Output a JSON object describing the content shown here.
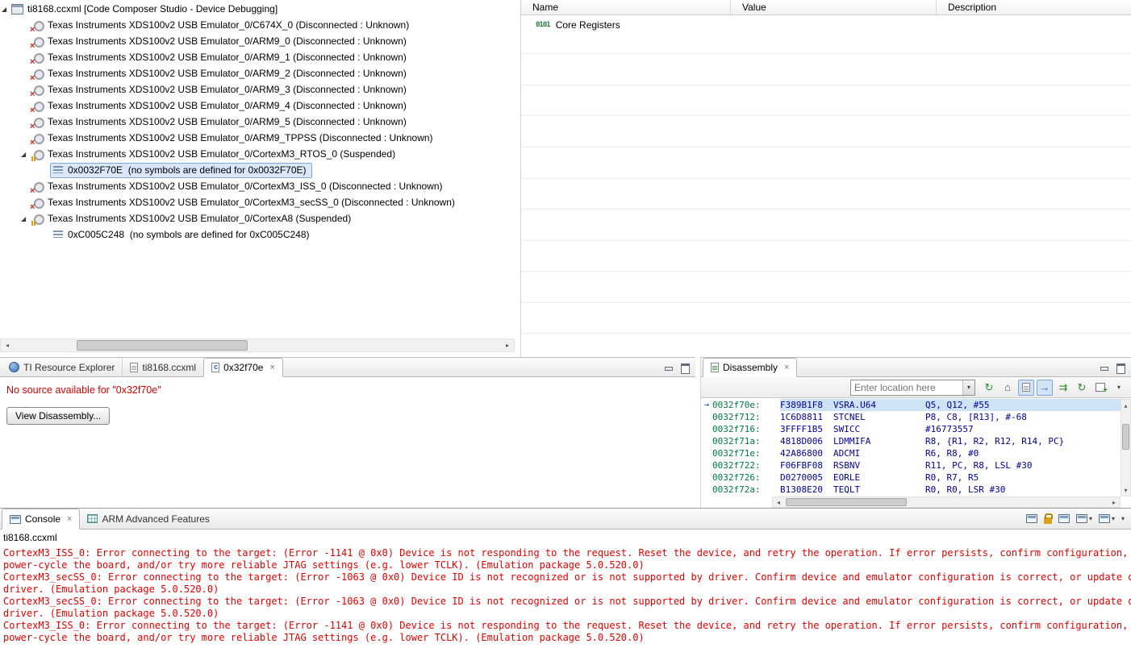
{
  "icons": {
    "expanded_twist": "◢",
    "close": "×",
    "dropdown": "▾",
    "scroll_left": "◂",
    "scroll_right": "▸",
    "scroll_up": "▴",
    "scroll_down": "▾",
    "instruction_pointer": "→",
    "home": "⌂",
    "refresh": "↻",
    "step_arrows": "⇉",
    "registers_bits": "0101"
  },
  "debug_tree": {
    "rows": [
      {
        "label": "ti8168.ccxml [Code Composer Studio - Device Debugging]"
      },
      {
        "label": "Texas Instruments XDS100v2 USB Emulator_0/C674X_0 (Disconnected : Unknown)"
      },
      {
        "label": "Texas Instruments XDS100v2 USB Emulator_0/ARM9_0 (Disconnected : Unknown)"
      },
      {
        "label": "Texas Instruments XDS100v2 USB Emulator_0/ARM9_1 (Disconnected : Unknown)"
      },
      {
        "label": "Texas Instruments XDS100v2 USB Emulator_0/ARM9_2 (Disconnected : Unknown)"
      },
      {
        "label": "Texas Instruments XDS100v2 USB Emulator_0/ARM9_3 (Disconnected : Unknown)"
      },
      {
        "label": "Texas Instruments XDS100v2 USB Emulator_0/ARM9_4 (Disconnected : Unknown)"
      },
      {
        "label": "Texas Instruments XDS100v2 USB Emulator_0/ARM9_5 (Disconnected : Unknown)"
      },
      {
        "label": "Texas Instruments XDS100v2 USB Emulator_0/ARM9_TPPSS (Disconnected : Unknown)"
      },
      {
        "label": "Texas Instruments XDS100v2 USB Emulator_0/CortexM3_RTOS_0 (Suspended)"
      },
      {
        "label": "0x0032F70E  (no symbols are defined for 0x0032F70E)"
      },
      {
        "label": "Texas Instruments XDS100v2 USB Emulator_0/CortexM3_ISS_0 (Disconnected : Unknown)"
      },
      {
        "label": "Texas Instruments XDS100v2 USB Emulator_0/CortexM3_secSS_0 (Disconnected : Unknown)"
      },
      {
        "label": "Texas Instruments XDS100v2 USB Emulator_0/CortexA8 (Suspended)"
      },
      {
        "label": "0xC005C248  (no symbols are defined for 0xC005C248)"
      }
    ]
  },
  "registers": {
    "columns": [
      "Name",
      "Value",
      "Description"
    ],
    "rows": [
      {
        "name": "Core Registers",
        "value": "",
        "description": ""
      }
    ]
  },
  "editor": {
    "tabs": [
      {
        "label": "TI Resource Explorer"
      },
      {
        "label": "ti8168.ccxml"
      },
      {
        "label": "0x32f70e"
      }
    ],
    "message": "No source available for \"0x32f70e\"",
    "button_label": "View Disassembly..."
  },
  "disassembly": {
    "tab_label": "Disassembly",
    "location_placeholder": "Enter location here",
    "rows": [
      {
        "addr": "0032f70e:",
        "code": "F389B1F8",
        "mn": "VSRA.U64",
        "ops": "Q5, Q12, #55"
      },
      {
        "addr": "0032f712:",
        "code": "1C6D8811",
        "mn": "STCNEL",
        "ops": "P8, C8, [R13], #-68"
      },
      {
        "addr": "0032f716:",
        "code": "3FFFF1B5",
        "mn": "SWICC",
        "ops": "#16773557"
      },
      {
        "addr": "0032f71a:",
        "code": "4818D006",
        "mn": "LDMMIFA",
        "ops": "R8, {R1, R2, R12, R14, PC}"
      },
      {
        "addr": "0032f71e:",
        "code": "42A86800",
        "mn": "ADCMI",
        "ops": "R6, R8, #0"
      },
      {
        "addr": "0032f722:",
        "code": "F06FBF08",
        "mn": "RSBNV",
        "ops": "R11, PC, R8, LSL #30"
      },
      {
        "addr": "0032f726:",
        "code": "D0270005",
        "mn": "EORLE",
        "ops": "R0, R7, R5"
      },
      {
        "addr": "0032f72a:",
        "code": "B1308E20",
        "mn": "TEQLT",
        "ops": "R0, R0, LSR #30"
      }
    ]
  },
  "console": {
    "tabs": [
      {
        "label": "Console"
      },
      {
        "label": "ARM Advanced Features"
      }
    ],
    "title": "ti8168.ccxml",
    "lines": [
      "CortexM3_ISS_0: Error connecting to the target: (Error -1141 @ 0x0) Device is not responding to the request. Reset the device, and retry the operation. If error persists, confirm configuration,",
      "power-cycle the board, and/or try more reliable JTAG settings (e.g. lower TCLK). (Emulation package 5.0.520.0)",
      "CortexM3_secSS_0: Error connecting to the target: (Error -1063 @ 0x0) Device ID is not recognized or is not supported by driver. Confirm device and emulator configuration is correct, or update device",
      "driver. (Emulation package 5.0.520.0)",
      "CortexM3_secSS_0: Error connecting to the target: (Error -1063 @ 0x0) Device ID is not recognized or is not supported by driver. Confirm device and emulator configuration is correct, or update device",
      "driver. (Emulation package 5.0.520.0)",
      "CortexM3_ISS_0: Error connecting to the target: (Error -1141 @ 0x0) Device is not responding to the request. Reset the device, and retry the operation. If error persists, confirm configuration,",
      "power-cycle the board, and/or try more reliable JTAG settings (e.g. lower TCLK). (Emulation package 5.0.520.0)"
    ]
  }
}
